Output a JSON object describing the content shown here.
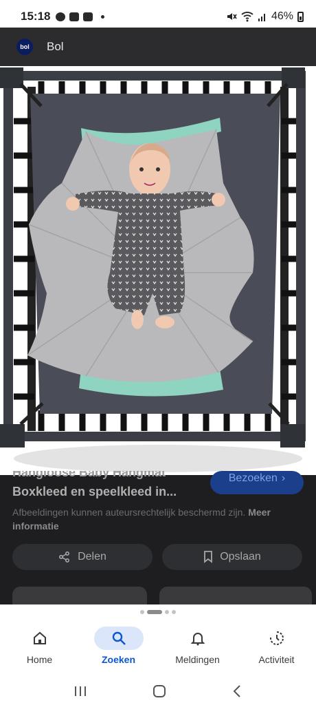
{
  "status_bar": {
    "time": "15:18",
    "battery": "46%"
  },
  "header": {
    "logo_text": "bol",
    "source_name": "Bol"
  },
  "image": {
    "alt_subject": "baby-in-hammock"
  },
  "result": {
    "title_partial": "Hangloose Baby Hangmat",
    "title": "Boxkleed en speelkleed in...",
    "visit_label": "Bezoeken",
    "copyright_text": "Afbeeldingen kunnen auteursrechtelijk beschermd zijn.",
    "copyright_more": "Meer informatie",
    "share_label": "Delen",
    "save_label": "Opslaan"
  },
  "bottom_nav": {
    "items": [
      {
        "label": "Home",
        "icon": "home-icon"
      },
      {
        "label": "Zoeken",
        "icon": "search-icon",
        "active": true
      },
      {
        "label": "Meldingen",
        "icon": "bell-icon"
      },
      {
        "label": "Activiteit",
        "icon": "activity-icon"
      }
    ]
  },
  "colors": {
    "accent": "#0b57d0",
    "active_pill": "#dce6fb",
    "dim_bg": "#1e1e20"
  }
}
